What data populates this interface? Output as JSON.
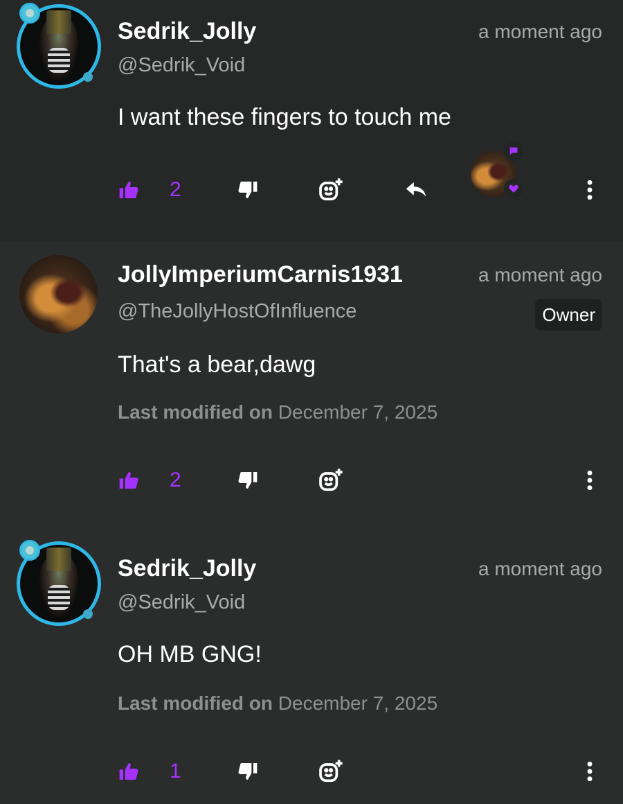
{
  "colors": {
    "accent": "#a632ff",
    "ring": "#2fb7e6",
    "muted": "#a9abaa"
  },
  "comments": [
    {
      "username": "Sedrik_Jolly",
      "handle": "@Sedrik_Void",
      "time": "a moment ago",
      "text": "I want these fingers to touch me",
      "likes": "2"
    },
    {
      "username": "JollyImperiumCarnis1931",
      "handle": "@TheJollyHostOfInfluence",
      "time": "a moment ago",
      "badge": "Owner",
      "text": "That's a bear,dawg",
      "modified_label": "Last modified on",
      "modified_date": "December 7, 2025",
      "likes": "2"
    },
    {
      "username": "Sedrik_Jolly",
      "handle": "@Sedrik_Void",
      "time": "a moment ago",
      "text": "OH MB GNG!",
      "modified_label": "Last modified on",
      "modified_date": "December 7, 2025",
      "likes": "1"
    }
  ]
}
